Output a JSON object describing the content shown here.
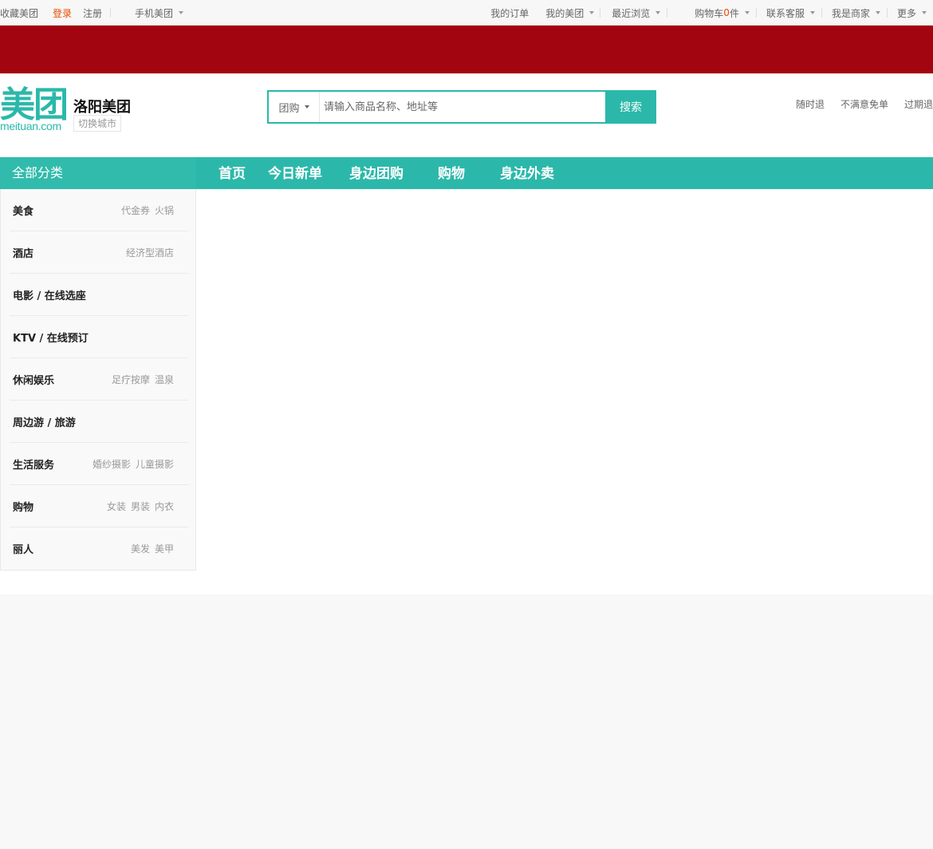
{
  "topbar": {
    "left": {
      "favorite": "收藏美团",
      "login": "登录",
      "register": "注册",
      "mobile": "手机美团"
    },
    "right": {
      "orders": "我的订单",
      "my_meituan": "我的美团",
      "recent": "最近浏览",
      "cart_prefix": "购物车",
      "cart_count": "0",
      "cart_suffix": "件",
      "service": "联系客服",
      "merchant": "我是商家",
      "more": "更多"
    }
  },
  "colors": {
    "brand": "#2bb8aa",
    "banner": "#a30510",
    "accent": "#e54d00"
  },
  "header": {
    "logo_cn": "美团",
    "logo_en": "meituan.com",
    "city": "洛阳美团",
    "switch_city": "切换城市",
    "search": {
      "type": "团购",
      "placeholder": "请输入商品名称、地址等",
      "button": "搜索"
    },
    "guarantees": [
      "随时退",
      "不满意免单",
      "过期退"
    ]
  },
  "nav": {
    "all_categories": "全部分类",
    "items": [
      "首页",
      "今日新单",
      "身边团购",
      "购物",
      "身边外卖"
    ]
  },
  "categories": [
    {
      "name": "美食",
      "subs": [
        "代金券",
        "火锅"
      ]
    },
    {
      "name": "酒店",
      "subs": [
        "经济型酒店"
      ]
    },
    {
      "name": "电影 / 在线选座",
      "subs": []
    },
    {
      "name": "KTV / 在线预订",
      "subs": []
    },
    {
      "name": "休闲娱乐",
      "subs": [
        "足疗按摩",
        "温泉"
      ]
    },
    {
      "name": "周边游 / 旅游",
      "subs": []
    },
    {
      "name": "生活服务",
      "subs": [
        "婚纱摄影",
        "儿童摄影"
      ]
    },
    {
      "name": "购物",
      "subs": [
        "女装",
        "男装",
        "内衣"
      ]
    },
    {
      "name": "丽人",
      "subs": [
        "美发",
        "美甲"
      ]
    }
  ]
}
